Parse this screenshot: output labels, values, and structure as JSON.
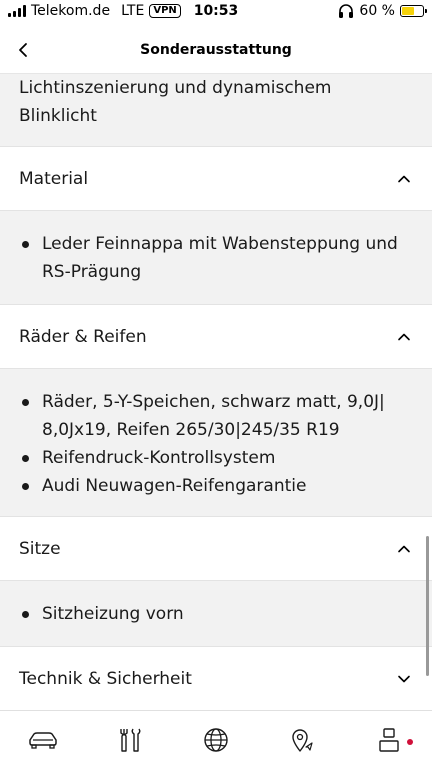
{
  "status_bar": {
    "carrier": "Telekom.de",
    "network": "LTE",
    "vpn": "VPN",
    "time": "10:53",
    "battery_percent_label": "60 %",
    "battery_level": 0.6,
    "battery_color": "#f5d20a"
  },
  "nav": {
    "title": "Sonderausstattung"
  },
  "top_panel": {
    "line1": "Lichtinszenierung und dynamischem",
    "line2": "Blinklicht"
  },
  "sections": [
    {
      "title": "Material",
      "state": "expanded",
      "items": [
        "Leder Feinnappa mit Wabensteppung und RS-Prägung"
      ]
    },
    {
      "title": "Räder & Reifen",
      "state": "expanded",
      "items": [
        "Räder, 5-Y-Speichen, schwarz matt, 9,0J| 8,0Jx19, Reifen 265/30|245/35 R19",
        "Reifendruck-Kontrollsystem",
        "Audi Neuwagen-Reifengarantie"
      ]
    },
    {
      "title": "Sitze",
      "state": "expanded",
      "items": [
        "Sitzheizung vorn"
      ]
    },
    {
      "title": "Technik & Sicherheit",
      "state": "collapsed",
      "items": []
    }
  ],
  "tab_bar": {
    "tabs": [
      "car-icon",
      "tools-icon",
      "globe-icon",
      "map-pin-icon",
      "profile-icon"
    ],
    "notification_color": "#d0103a"
  }
}
